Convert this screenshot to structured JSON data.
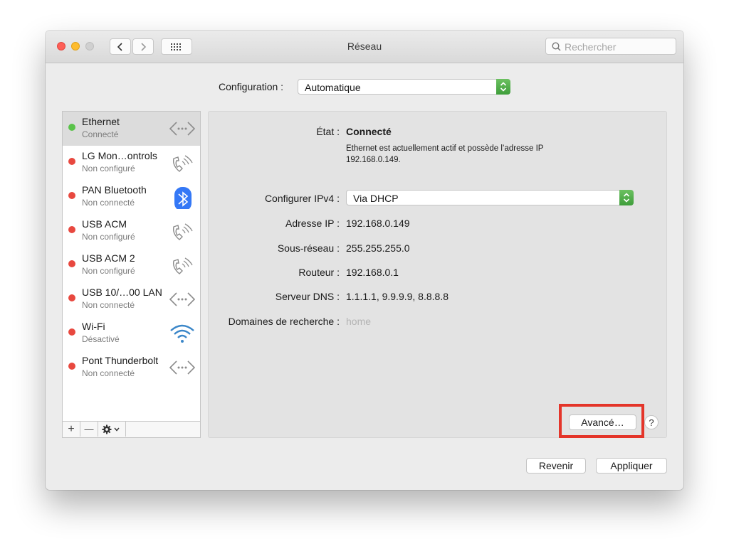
{
  "window": {
    "title": "Réseau",
    "search_placeholder": "Rechercher"
  },
  "configuration": {
    "label": "Configuration :",
    "value": "Automatique"
  },
  "services": [
    {
      "name": "Ethernet",
      "status": "Connecté",
      "color": "#5ac34a",
      "icon": "ethernet-icon"
    },
    {
      "name": "LG Mon…ontrols",
      "status": "Non configuré",
      "color": "#e8483f",
      "icon": "phone-icon"
    },
    {
      "name": "PAN Bluetooth",
      "status": "Non connecté",
      "color": "#e8483f",
      "icon": "bluetooth-icon"
    },
    {
      "name": "USB ACM",
      "status": "Non configuré",
      "color": "#e8483f",
      "icon": "phone-icon"
    },
    {
      "name": "USB ACM 2",
      "status": "Non configuré",
      "color": "#e8483f",
      "icon": "phone-icon"
    },
    {
      "name": "USB 10/…00 LAN",
      "status": "Non connecté",
      "color": "#e8483f",
      "icon": "ethernet-icon"
    },
    {
      "name": "Wi-Fi",
      "status": "Désactivé",
      "color": "#e8483f",
      "icon": "wifi-icon"
    },
    {
      "name": "Pont Thunderbolt",
      "status": "Non connecté",
      "color": "#e8483f",
      "icon": "ethernet-icon"
    }
  ],
  "sidebar_footer": {
    "add": "+",
    "remove": "—"
  },
  "detail": {
    "state_label": "État :",
    "state_value": "Connecté",
    "state_description_line1": "Ethernet est actuellement actif et possède l’adresse IP",
    "state_description_line2": "192.168.0.149.",
    "ipv4_label": "Configurer IPv4 :",
    "ipv4_value": "Via DHCP",
    "ip_label": "Adresse IP :",
    "ip_value": "192.168.0.149",
    "subnet_label": "Sous-réseau :",
    "subnet_value": "255.255.255.0",
    "router_label": "Routeur :",
    "router_value": "192.168.0.1",
    "dns_label": "Serveur DNS :",
    "dns_value": "1.1.1.1, 9.9.9.9, 8.8.8.8",
    "domains_label": "Domaines de recherche :",
    "domains_value": "home",
    "advanced_button": "Avancé…",
    "help_button": "?"
  },
  "footer": {
    "revert_button": "Revenir",
    "apply_button": "Appliquer"
  },
  "colors": {
    "connected": "#5ac34a",
    "disconnected": "#e8483f",
    "highlight": "#e4352a",
    "stepper": "#4caf45"
  }
}
